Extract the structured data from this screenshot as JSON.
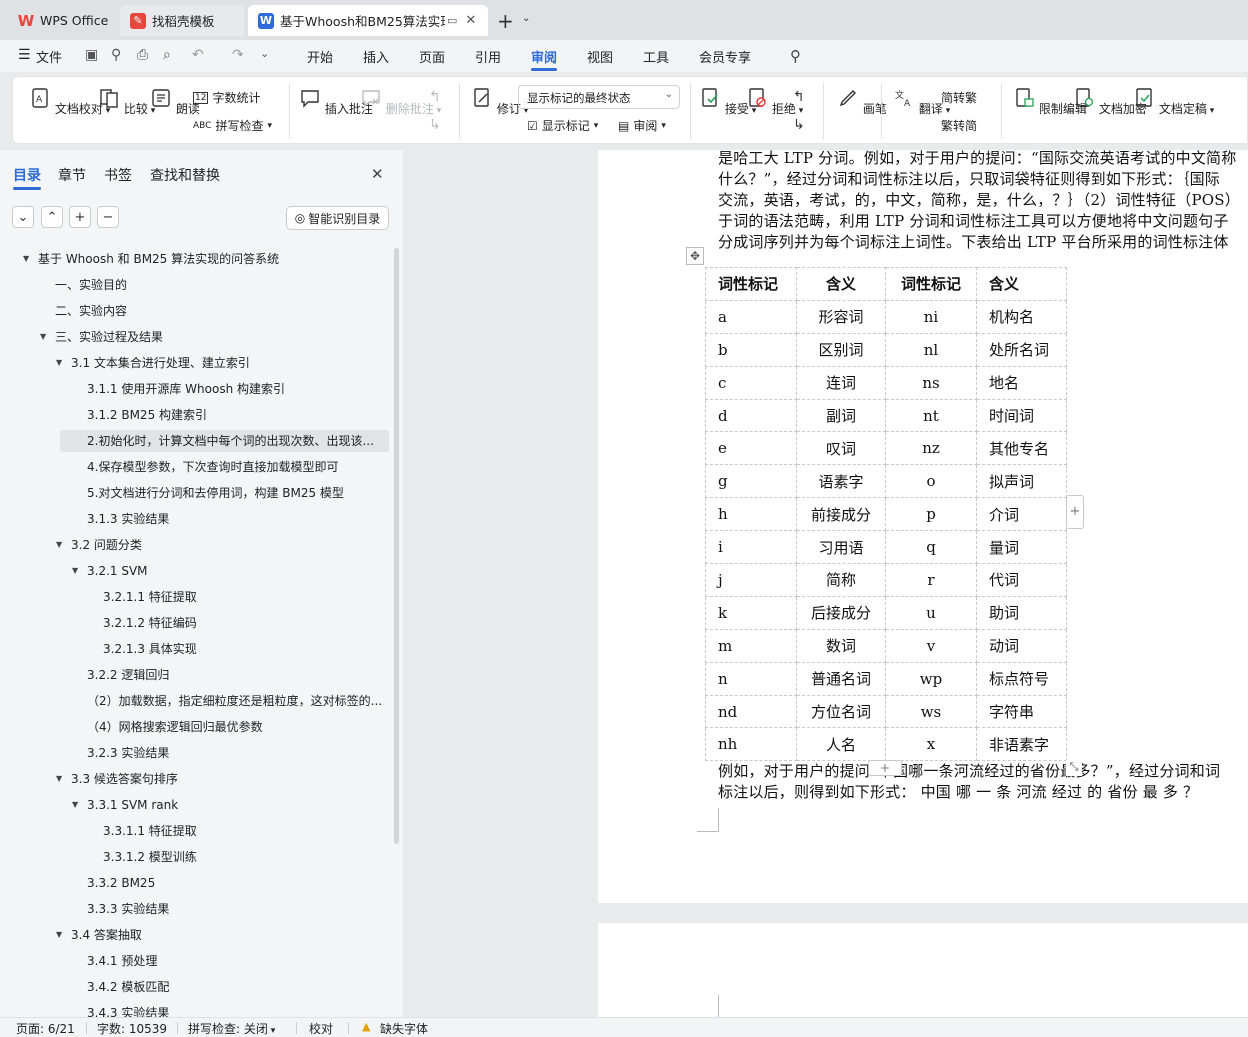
{
  "tabs": [
    {
      "label": "WPS Office",
      "icon": "wps-logo-icon",
      "color": "#e8453c"
    },
    {
      "label": "找稻壳模板",
      "icon": "docer-icon",
      "color": "#e8453c"
    },
    {
      "label": "基于Whoosh和BM25算法实现",
      "icon": "word-doc-icon",
      "color": "#2f6bd8"
    }
  ],
  "new_tab": "+",
  "menu": {
    "file": "文件",
    "items": [
      "开始",
      "插入",
      "页面",
      "引用",
      "审阅",
      "视图",
      "工具",
      "会员专享"
    ],
    "active": "审阅",
    "accent": "#2f6bd8"
  },
  "ribbon": {
    "proofread": "文档校对",
    "compare": "比较",
    "read_aloud": "朗读",
    "word_count": "字数统计",
    "spell_check": "拼写检查",
    "insert_comment": "插入批注",
    "delete_comment": "删除批注",
    "track": "修订",
    "display_mode": "显示标记的最终状态",
    "show_markup": "显示标记",
    "review": "审阅",
    "accept": "接受",
    "reject": "拒绝",
    "pen": "画笔",
    "translate": "翻译",
    "to_traditional": "简转繁",
    "to_simplified": "繁转简",
    "restrict": "限制编辑",
    "encrypt": "文档加密",
    "finalize": "文档定稿"
  },
  "nav": {
    "tabs": [
      "目录",
      "章节",
      "书签",
      "查找和替换"
    ],
    "active": "目录",
    "smart_toc": "智能识别目录",
    "items": [
      {
        "text": "基于 Whoosh 和 BM25 算法实现的问答系统",
        "level": 0,
        "expand": true
      },
      {
        "text": "一、实验目的",
        "level": 1
      },
      {
        "text": "二、实验内容",
        "level": 1
      },
      {
        "text": "三、实验过程及结果",
        "level": 1,
        "expand": true
      },
      {
        "text": "3.1  文本集合进行处理、建立索引",
        "level": 2,
        "expand": true
      },
      {
        "text": "3.1.1 使用开源库 Whoosh 构建索引",
        "level": 3
      },
      {
        "text": "3.1.2 BM25 构建索引",
        "level": 3
      },
      {
        "text": "2.初始化时，计算文档中每个词的出现次数、出现该...",
        "level": 3,
        "selected": true
      },
      {
        "text": "4.保存模型参数，下次查询时直接加载模型即可",
        "level": 3
      },
      {
        "text": "5.对文档进行分词和去停用词，构建 BM25 模型",
        "level": 3
      },
      {
        "text": "3.1.3  实验结果",
        "level": 3
      },
      {
        "text": "3.2 问题分类",
        "level": 2,
        "expand": true
      },
      {
        "text": "3.2.1 SVM",
        "level": 3,
        "expand": true
      },
      {
        "text": "3.2.1.1  特征提取",
        "level": 4
      },
      {
        "text": "3.2.1.2  特征编码",
        "level": 4
      },
      {
        "text": "3.2.1.3  具体实现",
        "level": 4
      },
      {
        "text": "3.2.2  逻辑回归",
        "level": 3
      },
      {
        "text": "（2）加载数据，指定细粒度还是粗粒度，这对标签的...",
        "level": 3
      },
      {
        "text": "（4）网格搜索逻辑回归最优参数",
        "level": 3
      },
      {
        "text": "3.2.3 实验结果",
        "level": 3
      },
      {
        "text": "3.3  候选答案句排序",
        "level": 2,
        "expand": true
      },
      {
        "text": "3.3.1 SVM rank",
        "level": 3,
        "expand": true
      },
      {
        "text": "3.3.1.1  特征提取",
        "level": 4
      },
      {
        "text": "3.3.1.2  模型训练",
        "level": 4
      },
      {
        "text": "3.3.2 BM25",
        "level": 3
      },
      {
        "text": "3.3.3  实验结果",
        "level": 3
      },
      {
        "text": "3.4  答案抽取",
        "level": 2,
        "expand": true
      },
      {
        "text": "3.4.1 预处理",
        "level": 3
      },
      {
        "text": "3.4.2 模板匹配",
        "level": 3
      },
      {
        "text": "3.4.3 实验结果",
        "level": 3
      }
    ]
  },
  "doc": {
    "para_top": [
      "是哈工大 LTP 分词。例如，对于用户的提问：“国际交流英语考试的中文简称",
      "什么？”，经过分词和词性标注以后，只取词袋特征则得到如下形式：｛国际",
      "交流，英语，考试，的，中文，简称，是，什么，？｝（2）词性特征（POS）",
      "于词的语法范畴，利用 LTP 分词和词性标注工具可以方便地将中文问题句子",
      "分成词序列并为每个词标注上词性。下表给出 LTP 平台所采用的词性标注体"
    ],
    "table_header": [
      "词性标记",
      "含义",
      "词性标记",
      "含义"
    ],
    "table_rows": [
      [
        "a",
        "形容词",
        "ni",
        "机构名"
      ],
      [
        "b",
        "区别词",
        "nl",
        "处所名词"
      ],
      [
        "c",
        "连词",
        "ns",
        "地名"
      ],
      [
        "d",
        "副词",
        "nt",
        "时间词"
      ],
      [
        "e",
        "叹词",
        "nz",
        "其他专名"
      ],
      [
        "g",
        "语素字",
        "o",
        "拟声词"
      ],
      [
        "h",
        "前接成分",
        "p",
        "介词"
      ],
      [
        "i",
        "习用语",
        "q",
        "量词"
      ],
      [
        "j",
        "简称",
        "r",
        "代词"
      ],
      [
        "k",
        "后接成分",
        "u",
        "助词"
      ],
      [
        "m",
        "数词",
        "v",
        "动词"
      ],
      [
        "n",
        "普通名词",
        "wp",
        "标点符号"
      ],
      [
        "nd",
        "方位名词",
        "ws",
        "字符串"
      ],
      [
        "nh",
        "人名",
        "x",
        "非语素字"
      ]
    ],
    "para_bottom": [
      "例如，对于用户的提问“中国哪一条河流经过的省份最多？”，经过分词和词",
      "标注以后，则得到如下形式：  中国  哪  一  条  河流  经过  的  省份  最  多  ？"
    ]
  },
  "status": {
    "page": "页面: 6/21",
    "words": "字数: 10539",
    "spell": "拼写检查: 关闭",
    "proof": "校对",
    "missing_font": "缺失字体"
  }
}
